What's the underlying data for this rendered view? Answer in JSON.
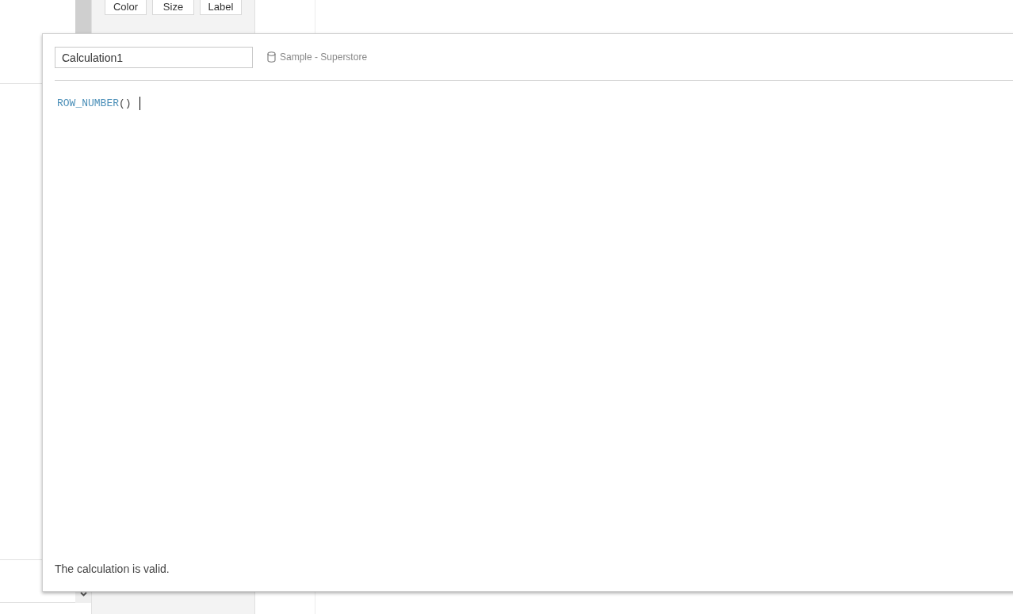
{
  "marks_card": {
    "buttons": [
      "Color",
      "Size",
      "Label"
    ]
  },
  "calculation_editor": {
    "name": "Calculation1",
    "data_source": "Sample - Superstore",
    "formula": [
      {
        "kind": "function",
        "text": "ROW_NUMBER"
      },
      {
        "kind": "punctuation",
        "text": "()"
      }
    ],
    "status": "The calculation is valid."
  }
}
